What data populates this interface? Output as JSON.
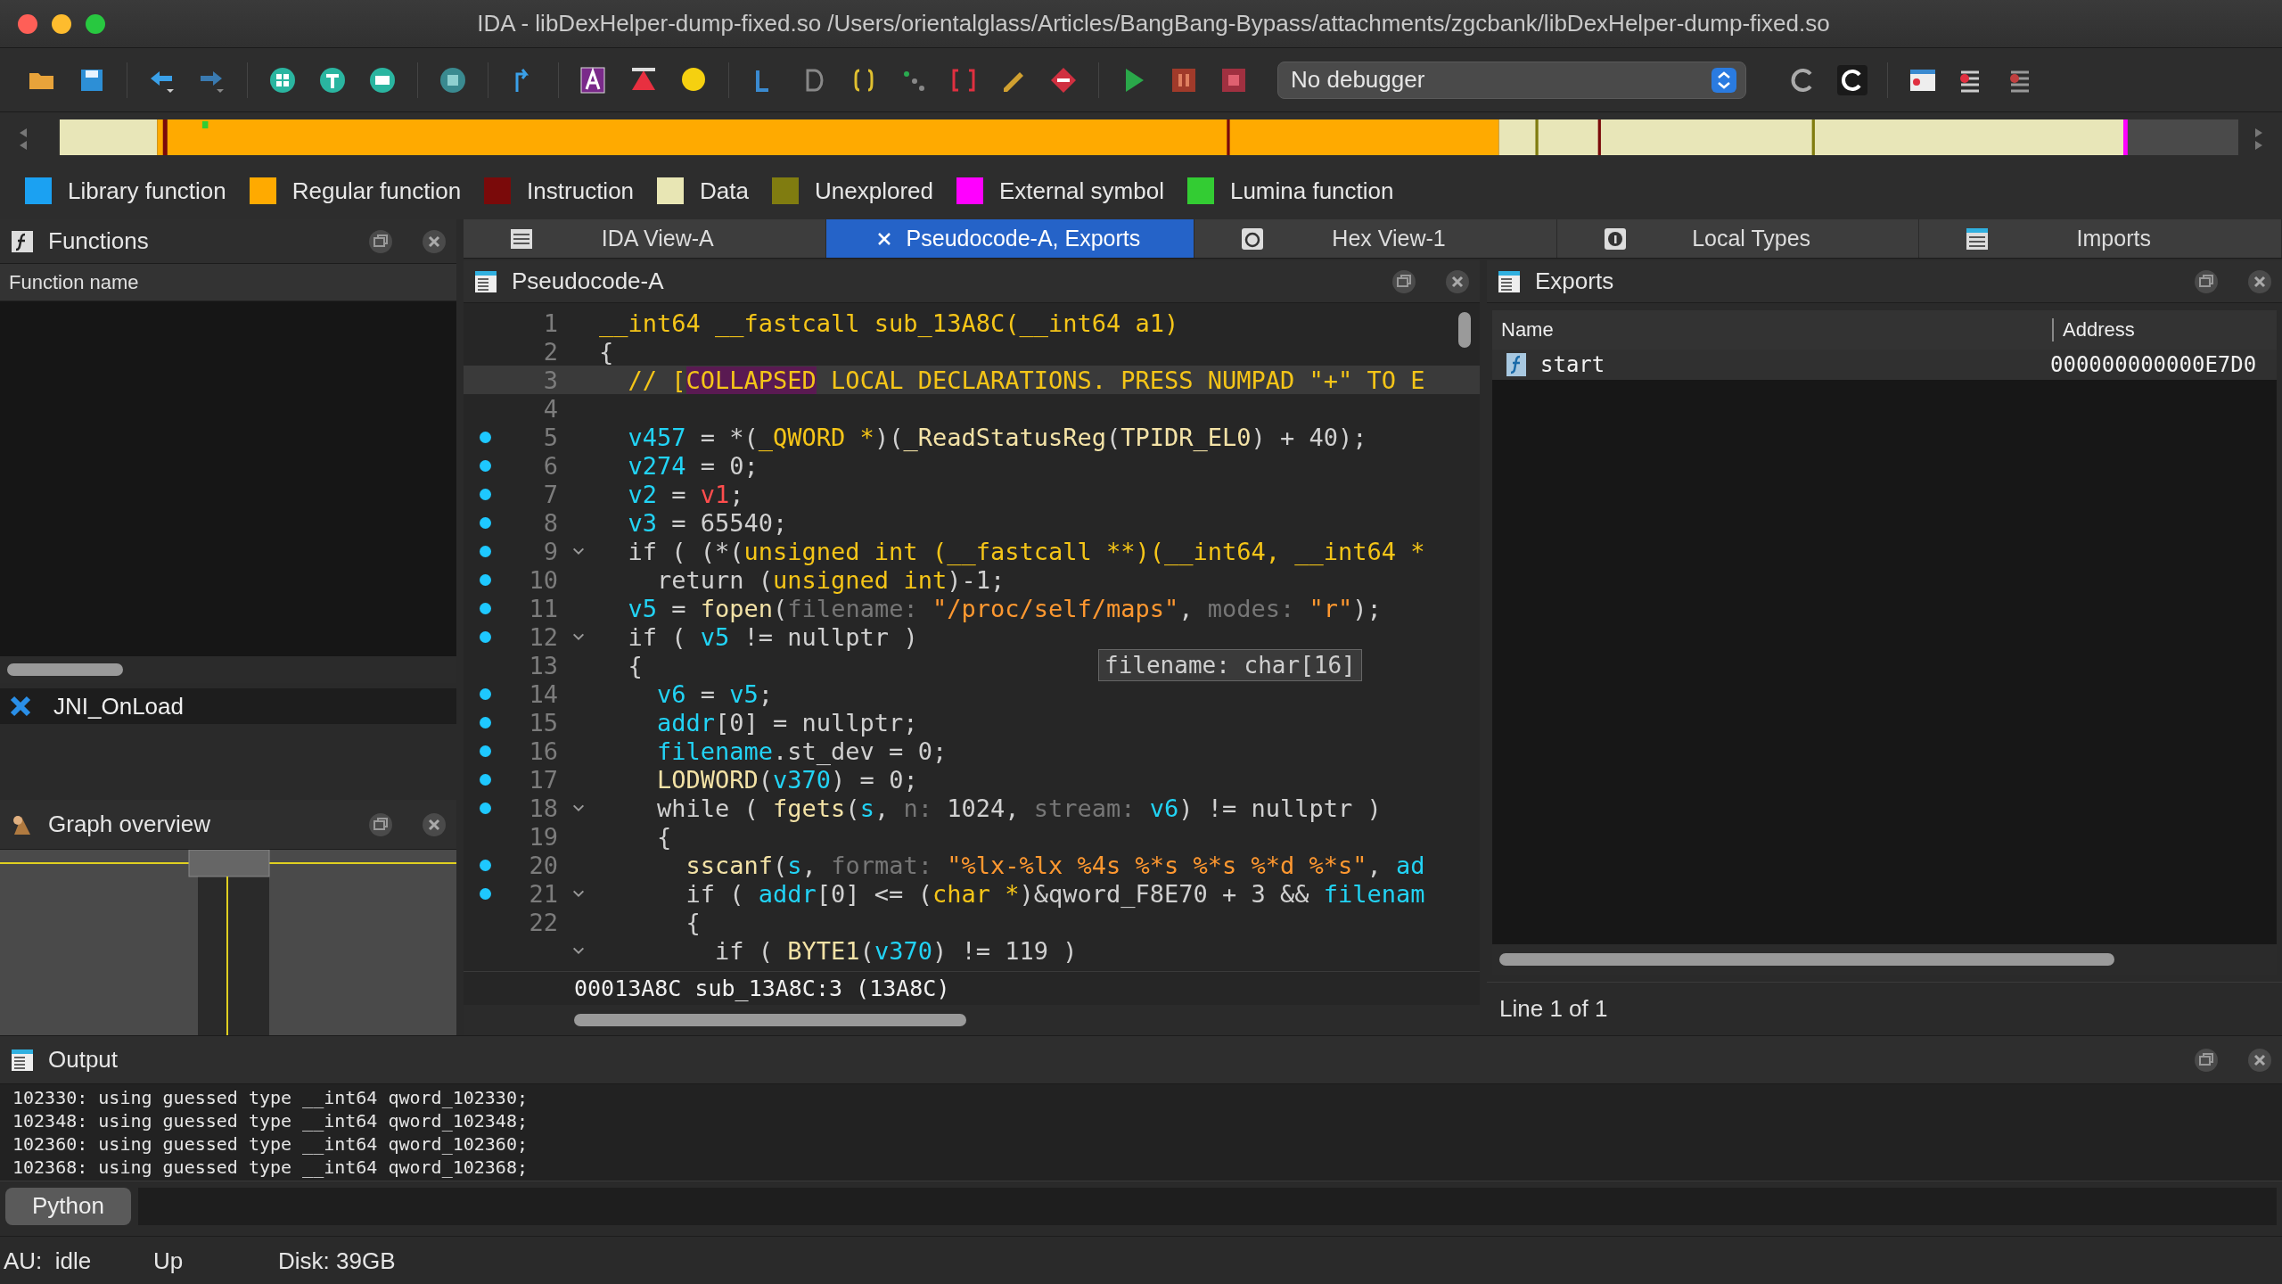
{
  "window": {
    "title": "IDA - libDexHelper-dump-fixed.so /Users/orientalglass/Articles/BangBang-Bypass/attachments/zgcbank/libDexHelper-dump-fixed.so"
  },
  "toolbar": {
    "debugger": "No debugger"
  },
  "legend": [
    {
      "label": "Library function",
      "color": "#1ba1f2"
    },
    {
      "label": "Regular function",
      "color": "#ffaa00"
    },
    {
      "label": "Instruction",
      "color": "#7a0a0a"
    },
    {
      "label": "Data",
      "color": "#e8e6b4"
    },
    {
      "label": "Unexplored",
      "color": "#807c10"
    },
    {
      "label": "External symbol",
      "color": "#ff00ff"
    },
    {
      "label": "Lumina function",
      "color": "#33cc33"
    }
  ],
  "functions_panel": {
    "title": "Functions",
    "column": "Function name",
    "items": [
      {
        "name": "JNI_OnLoad"
      }
    ]
  },
  "graph_overview": {
    "title": "Graph overview"
  },
  "tabs": [
    {
      "label": "IDA View-A",
      "selected": false
    },
    {
      "label": "Pseudocode-A, Exports",
      "selected": true
    },
    {
      "label": "Hex View-1",
      "selected": false
    },
    {
      "label": "Local Types",
      "selected": false
    },
    {
      "label": "Imports",
      "selected": false
    }
  ],
  "pseudocode": {
    "title": "Pseudocode-A",
    "tooltip": "filename: char[16]",
    "status": "00013A8C sub_13A8C:3 (13A8C)",
    "lines": [
      {
        "number": "1",
        "marked": false,
        "foldable": false,
        "current": false,
        "tokens": [
          {
            "text": "__int64 __fastcall sub_13A8C(__int64 a1)",
            "kind": "type"
          }
        ]
      },
      {
        "number": "2",
        "marked": false,
        "foldable": false,
        "current": false,
        "tokens": [
          {
            "text": "{",
            "kind": "plain"
          }
        ]
      },
      {
        "number": "3",
        "marked": false,
        "foldable": false,
        "current": true,
        "tokens": [
          {
            "text": "  // [",
            "kind": "comment"
          },
          {
            "text": "COLLAPSED",
            "kind": "collapsed"
          },
          {
            "text": " LOCAL DECLARATIONS. PRESS NUMPAD \"+\" TO E",
            "kind": "comment"
          }
        ]
      },
      {
        "number": "4",
        "marked": false,
        "foldable": false,
        "current": false
      },
      {
        "number": "5",
        "marked": true,
        "foldable": false,
        "current": false,
        "tokens": [
          {
            "text": "  v457",
            "kind": "var"
          },
          {
            "text": " = *(",
            "kind": "plain"
          },
          {
            "text": "_QWORD *",
            "kind": "type"
          },
          {
            "text": ")(",
            "kind": "plain"
          },
          {
            "text": "_ReadStatusReg",
            "kind": "func"
          },
          {
            "text": "(",
            "kind": "plain"
          },
          {
            "text": "TPIDR_EL0",
            "kind": "func"
          },
          {
            "text": ") + 40);",
            "kind": "plain"
          }
        ]
      },
      {
        "number": "6",
        "marked": true,
        "foldable": false,
        "current": false,
        "tokens": [
          {
            "text": "  v274",
            "kind": "var"
          },
          {
            "text": " = 0;",
            "kind": "plain"
          }
        ]
      },
      {
        "number": "7",
        "marked": true,
        "foldable": false,
        "current": false,
        "tokens": [
          {
            "text": "  v2",
            "kind": "var"
          },
          {
            "text": " = ",
            "kind": "plain"
          },
          {
            "text": "v1",
            "kind": "error"
          },
          {
            "text": ";",
            "kind": "plain"
          }
        ]
      },
      {
        "number": "8",
        "marked": true,
        "foldable": false,
        "current": false,
        "tokens": [
          {
            "text": "  v3",
            "kind": "var"
          },
          {
            "text": " = 65540;",
            "kind": "plain"
          }
        ]
      },
      {
        "number": "9",
        "marked": true,
        "foldable": true,
        "current": false,
        "tokens": [
          {
            "text": "  if ( (*(",
            "kind": "plain"
          },
          {
            "text": "unsigned int (__fastcall **)(__int64, __int64 *",
            "kind": "type"
          }
        ]
      },
      {
        "number": "10",
        "marked": true,
        "foldable": false,
        "current": false,
        "tokens": [
          {
            "text": "    return (",
            "kind": "plain"
          },
          {
            "text": "unsigned int",
            "kind": "type"
          },
          {
            "text": ")-1;",
            "kind": "plain"
          }
        ]
      },
      {
        "number": "11",
        "marked": true,
        "foldable": false,
        "current": false,
        "tokens": [
          {
            "text": "  v5",
            "kind": "var"
          },
          {
            "text": " = ",
            "kind": "plain"
          },
          {
            "text": "fopen",
            "kind": "func"
          },
          {
            "text": "(",
            "kind": "plain"
          },
          {
            "text": "filename: ",
            "kind": "hint"
          },
          {
            "text": "\"/proc/self/maps\"",
            "kind": "string"
          },
          {
            "text": ", ",
            "kind": "plain"
          },
          {
            "text": "modes: ",
            "kind": "hint"
          },
          {
            "text": "\"r\"",
            "kind": "string"
          },
          {
            "text": ");",
            "kind": "plain"
          }
        ]
      },
      {
        "number": "12",
        "marked": true,
        "foldable": true,
        "current": false,
        "tokens": [
          {
            "text": "  if ( ",
            "kind": "plain"
          },
          {
            "text": "v5",
            "kind": "var"
          },
          {
            "text": " != nullptr )",
            "kind": "plain"
          }
        ]
      },
      {
        "number": "13",
        "marked": false,
        "foldable": false,
        "current": false,
        "tokens": [
          {
            "text": "  {",
            "kind": "plain"
          }
        ]
      },
      {
        "number": "14",
        "marked": true,
        "foldable": false,
        "current": false,
        "tokens": [
          {
            "text": "    v6",
            "kind": "var"
          },
          {
            "text": " = ",
            "kind": "plain"
          },
          {
            "text": "v5",
            "kind": "var"
          },
          {
            "text": ";",
            "kind": "plain"
          }
        ]
      },
      {
        "number": "15",
        "marked": true,
        "foldable": false,
        "current": false,
        "tokens": [
          {
            "text": "    addr",
            "kind": "var"
          },
          {
            "text": "[0] = nullptr;",
            "kind": "plain"
          }
        ]
      },
      {
        "number": "16",
        "marked": true,
        "foldable": false,
        "current": false,
        "tokens": [
          {
            "text": "    filename",
            "kind": "var"
          },
          {
            "text": ".st_dev = 0;",
            "kind": "plain"
          }
        ]
      },
      {
        "number": "17",
        "marked": true,
        "foldable": false,
        "current": false,
        "tokens": [
          {
            "text": "    LODWORD",
            "kind": "func"
          },
          {
            "text": "(",
            "kind": "plain"
          },
          {
            "text": "v370",
            "kind": "var"
          },
          {
            "text": ") = 0;",
            "kind": "plain"
          }
        ]
      },
      {
        "number": "18",
        "marked": true,
        "foldable": true,
        "current": false,
        "tokens": [
          {
            "text": "    while ( ",
            "kind": "plain"
          },
          {
            "text": "fgets",
            "kind": "func"
          },
          {
            "text": "(",
            "kind": "plain"
          },
          {
            "text": "s",
            "kind": "var"
          },
          {
            "text": ", ",
            "kind": "plain"
          },
          {
            "text": "n: ",
            "kind": "hint"
          },
          {
            "text": "1024, ",
            "kind": "plain"
          },
          {
            "text": "stream: ",
            "kind": "hint"
          },
          {
            "text": "v6",
            "kind": "var"
          },
          {
            "text": ") != nullptr )",
            "kind": "plain"
          }
        ]
      },
      {
        "number": "19",
        "marked": false,
        "foldable": false,
        "current": false,
        "tokens": [
          {
            "text": "    {",
            "kind": "plain"
          }
        ]
      },
      {
        "number": "20",
        "marked": true,
        "foldable": false,
        "current": false,
        "tokens": [
          {
            "text": "      sscanf",
            "kind": "func"
          },
          {
            "text": "(",
            "kind": "plain"
          },
          {
            "text": "s",
            "kind": "var"
          },
          {
            "text": ", ",
            "kind": "plain"
          },
          {
            "text": "format: ",
            "kind": "hint"
          },
          {
            "text": "\"%lx-%lx %4s %*s %*s %*d %*s\"",
            "kind": "string"
          },
          {
            "text": ", ",
            "kind": "plain"
          },
          {
            "text": "ad",
            "kind": "var"
          }
        ]
      },
      {
        "number": "21",
        "marked": true,
        "foldable": true,
        "current": false,
        "tokens": [
          {
            "text": "      if ( ",
            "kind": "plain"
          },
          {
            "text": "addr",
            "kind": "var"
          },
          {
            "text": "[0] <= (",
            "kind": "plain"
          },
          {
            "text": "char *",
            "kind": "type"
          },
          {
            "text": ")&qword_F8E70 + 3 && ",
            "kind": "plain"
          },
          {
            "text": "filenam",
            "kind": "var"
          }
        ]
      },
      {
        "number": "22",
        "marked": false,
        "foldable": false,
        "current": false,
        "tokens": [
          {
            "text": "      {",
            "kind": "plain"
          }
        ]
      },
      {
        "marked": false,
        "foldable": true,
        "current": false,
        "tokens": [
          {
            "text": "        if ( ",
            "kind": "plain"
          },
          {
            "text": "BYTE1",
            "kind": "func"
          },
          {
            "text": "(",
            "kind": "plain"
          },
          {
            "text": "v370",
            "kind": "var"
          },
          {
            "text": ") != 119 )",
            "kind": "plain"
          }
        ]
      }
    ]
  },
  "exports": {
    "title": "Exports",
    "columns": [
      "Name",
      "Address"
    ],
    "rows": [
      {
        "name": "start",
        "address": "000000000000E7D0"
      }
    ],
    "footer": "Line 1 of 1"
  },
  "output": {
    "title": "Output",
    "lines": [
      "102330: using guessed type __int64 qword_102330;",
      "102348: using guessed type __int64 qword_102348;",
      "102360: using guessed type __int64 qword_102360;",
      "102368: using guessed type __int64 qword_102368;"
    ],
    "interpreter": "Python"
  },
  "status_bar": [
    "AU:  idle",
    "Up",
    "Disk: 39GB"
  ]
}
